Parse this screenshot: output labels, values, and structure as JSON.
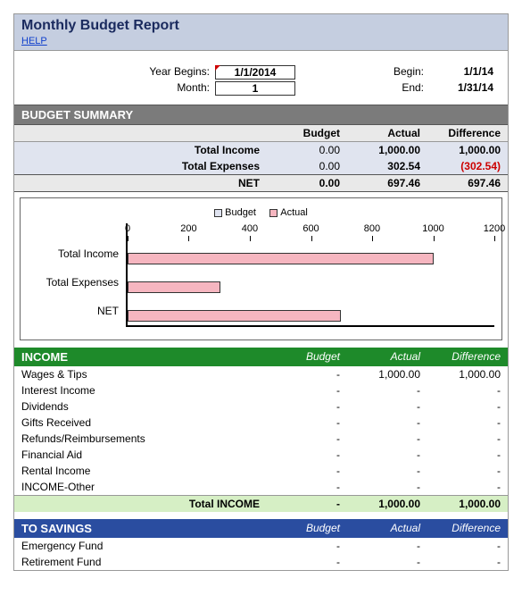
{
  "header": {
    "title": "Monthly Budget Report",
    "help_link": "HELP"
  },
  "dates": {
    "year_begins_label": "Year Begins:",
    "year_begins_value": "1/1/2014",
    "month_label": "Month:",
    "month_value": "1",
    "begin_label": "Begin:",
    "begin_value": "1/1/14",
    "end_label": "End:",
    "end_value": "1/31/14"
  },
  "summary": {
    "section_label": "BUDGET SUMMARY",
    "col1": "Budget",
    "col2": "Actual",
    "col3": "Difference",
    "rows": [
      {
        "label": "Total Income",
        "budget": "0.00",
        "actual": "1,000.00",
        "diff": "1,000.00",
        "neg": false
      },
      {
        "label": "Total Expenses",
        "budget": "0.00",
        "actual": "302.54",
        "diff": "(302.54)",
        "neg": true
      }
    ],
    "net": {
      "label": "NET",
      "budget": "0.00",
      "actual": "697.46",
      "diff": "697.46"
    }
  },
  "income": {
    "section_label": "INCOME",
    "col1": "Budget",
    "col2": "Actual",
    "col3": "Difference",
    "items": [
      {
        "label": "Wages & Tips",
        "budget": "-",
        "actual": "1,000.00",
        "diff": "1,000.00"
      },
      {
        "label": "Interest Income",
        "budget": "-",
        "actual": "-",
        "diff": "-"
      },
      {
        "label": "Dividends",
        "budget": "-",
        "actual": "-",
        "diff": "-"
      },
      {
        "label": "Gifts Received",
        "budget": "-",
        "actual": "-",
        "diff": "-"
      },
      {
        "label": "Refunds/Reimbursements",
        "budget": "-",
        "actual": "-",
        "diff": "-"
      },
      {
        "label": "Financial Aid",
        "budget": "-",
        "actual": "-",
        "diff": "-"
      },
      {
        "label": "Rental Income",
        "budget": "-",
        "actual": "-",
        "diff": "-"
      },
      {
        "label": "INCOME-Other",
        "budget": "-",
        "actual": "-",
        "diff": "-"
      }
    ],
    "total": {
      "label": "Total INCOME",
      "budget": "-",
      "actual": "1,000.00",
      "diff": "1,000.00"
    }
  },
  "savings": {
    "section_label": "TO SAVINGS",
    "col1": "Budget",
    "col2": "Actual",
    "col3": "Difference",
    "items": [
      {
        "label": "Emergency Fund",
        "budget": "-",
        "actual": "-",
        "diff": "-"
      },
      {
        "label": "Retirement Fund",
        "budget": "-",
        "actual": "-",
        "diff": "-"
      }
    ]
  },
  "chart_data": {
    "type": "bar",
    "orientation": "horizontal",
    "categories": [
      "Total Income",
      "Total Expenses",
      "NET"
    ],
    "series": [
      {
        "name": "Budget",
        "values": [
          0,
          0,
          0
        ],
        "color": "#dfe3f0"
      },
      {
        "name": "Actual",
        "values": [
          1000,
          302.54,
          697.46
        ],
        "color": "#f6b6c0"
      }
    ],
    "xlim": [
      0,
      1200
    ],
    "xticks": [
      0,
      200,
      400,
      600,
      800,
      1000,
      1200
    ],
    "legend": [
      "Budget",
      "Actual"
    ]
  }
}
